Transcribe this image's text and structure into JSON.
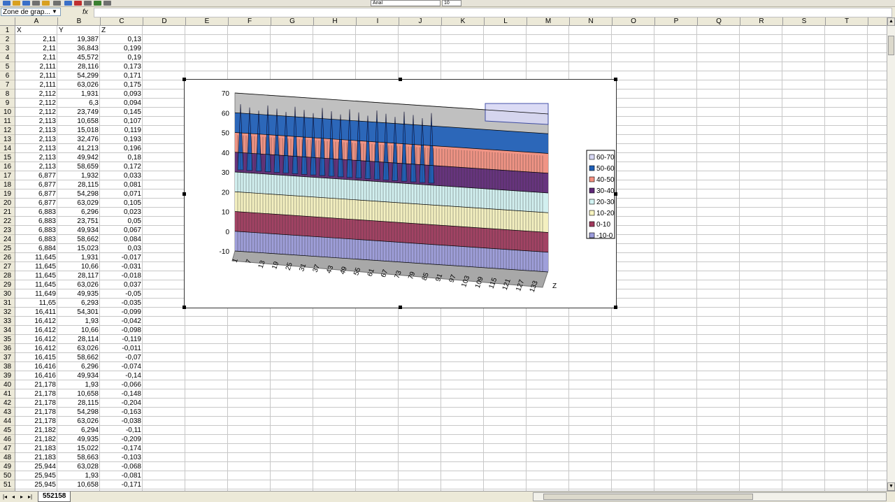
{
  "toolbar": {
    "font_name": "Arial",
    "font_size": "10"
  },
  "formula_bar": {
    "name_box": "Zone de grap...",
    "fx": "fx",
    "formula": ""
  },
  "columns": [
    "A",
    "B",
    "C",
    "D",
    "E",
    "F",
    "G",
    "H",
    "I",
    "J",
    "K",
    "L",
    "M",
    "N",
    "O",
    "P",
    "Q",
    "R",
    "S",
    "T"
  ],
  "rows": [
    "1",
    "2",
    "3",
    "4",
    "5",
    "6",
    "7",
    "8",
    "9",
    "10",
    "11",
    "12",
    "13",
    "14",
    "15",
    "16",
    "17",
    "18",
    "19",
    "20",
    "21",
    "22",
    "23",
    "24",
    "25",
    "26",
    "27",
    "28",
    "29",
    "30",
    "31",
    "32",
    "33",
    "34",
    "35",
    "36",
    "37",
    "38",
    "39",
    "40",
    "41",
    "42",
    "43",
    "44",
    "45",
    "46",
    "47",
    "48",
    "49",
    "50",
    "51"
  ],
  "headers": {
    "a": "X",
    "b": "Y",
    "c": "Z"
  },
  "data": [
    [
      "2,11",
      "19,387",
      "0,13"
    ],
    [
      "2,11",
      "36,843",
      "0,199"
    ],
    [
      "2,11",
      "45,572",
      "0,19"
    ],
    [
      "2,111",
      "28,116",
      "0,173"
    ],
    [
      "2,111",
      "54,299",
      "0,171"
    ],
    [
      "2,111",
      "63,026",
      "0,175"
    ],
    [
      "2,112",
      "1,931",
      "0,093"
    ],
    [
      "2,112",
      "6,3",
      "0,094"
    ],
    [
      "2,112",
      "23,749",
      "0,145"
    ],
    [
      "2,113",
      "10,658",
      "0,107"
    ],
    [
      "2,113",
      "15,018",
      "0,119"
    ],
    [
      "2,113",
      "32,476",
      "0,193"
    ],
    [
      "2,113",
      "41,213",
      "0,196"
    ],
    [
      "2,113",
      "49,942",
      "0,18"
    ],
    [
      "2,113",
      "58,659",
      "0,172"
    ],
    [
      "6,877",
      "1,932",
      "0,033"
    ],
    [
      "6,877",
      "28,115",
      "0,081"
    ],
    [
      "6,877",
      "54,298",
      "0,071"
    ],
    [
      "6,877",
      "63,029",
      "0,105"
    ],
    [
      "6,883",
      "6,296",
      "0,023"
    ],
    [
      "6,883",
      "23,751",
      "0,05"
    ],
    [
      "6,883",
      "49,934",
      "0,067"
    ],
    [
      "6,883",
      "58,662",
      "0,084"
    ],
    [
      "6,884",
      "15,023",
      "0,03"
    ],
    [
      "11,645",
      "1,931",
      "-0,017"
    ],
    [
      "11,645",
      "10,66",
      "-0,031"
    ],
    [
      "11,645",
      "28,117",
      "-0,018"
    ],
    [
      "11,645",
      "63,026",
      "0,037"
    ],
    [
      "11,649",
      "49,935",
      "-0,05"
    ],
    [
      "11,65",
      "6,293",
      "-0,035"
    ],
    [
      "16,411",
      "54,301",
      "-0,099"
    ],
    [
      "16,412",
      "1,93",
      "-0,042"
    ],
    [
      "16,412",
      "10,66",
      "-0,098"
    ],
    [
      "16,412",
      "28,114",
      "-0,119"
    ],
    [
      "16,412",
      "63,026",
      "-0,011"
    ],
    [
      "16,415",
      "58,662",
      "-0,07"
    ],
    [
      "16,416",
      "6,296",
      "-0,074"
    ],
    [
      "16,416",
      "49,934",
      "-0,14"
    ],
    [
      "21,178",
      "1,93",
      "-0,066"
    ],
    [
      "21,178",
      "10,658",
      "-0,148"
    ],
    [
      "21,178",
      "28,115",
      "-0,204"
    ],
    [
      "21,178",
      "54,298",
      "-0,163"
    ],
    [
      "21,178",
      "63,026",
      "-0,038"
    ],
    [
      "21,182",
      "6,294",
      "-0,11"
    ],
    [
      "21,182",
      "49,935",
      "-0,209"
    ],
    [
      "21,183",
      "15,022",
      "-0,174"
    ],
    [
      "21,183",
      "58,663",
      "-0,103"
    ],
    [
      "25,944",
      "63,028",
      "-0,068"
    ],
    [
      "25,945",
      "1,93",
      "-0,081"
    ],
    [
      "25,945",
      "10,658",
      "-0,171"
    ]
  ],
  "chart": {
    "type": "surface",
    "y_ticks": [
      "70",
      "60",
      "50",
      "40",
      "30",
      "20",
      "10",
      "0",
      "-10"
    ],
    "x_ticks": [
      "1",
      "7",
      "13",
      "19",
      "25",
      "31",
      "37",
      "43",
      "49",
      "55",
      "61",
      "67",
      "73",
      "79",
      "85",
      "91",
      "97",
      "103",
      "109",
      "115",
      "121",
      "127",
      "133"
    ],
    "depth_label": "Z",
    "legend": [
      "60-70",
      "50-60",
      "40-50",
      "30-40",
      "20-30",
      "10-20",
      "0-10",
      "-10-0"
    ],
    "legend_colors": [
      "#d8d8f4",
      "#2060b8",
      "#f49080",
      "#602878",
      "#d4f4f4",
      "#f8f4c0",
      "#a0385c",
      "#9c9cdc"
    ],
    "wall_color": "#c0c0c0"
  },
  "sheet_tab": "552158",
  "icons": [
    "new-icon",
    "open-icon",
    "save-icon",
    "print-icon",
    "chart-wizard-icon",
    "bold-icon",
    "italic-icon",
    "underline-icon",
    "borders-icon",
    "fill-color-icon",
    "font-color-icon"
  ]
}
